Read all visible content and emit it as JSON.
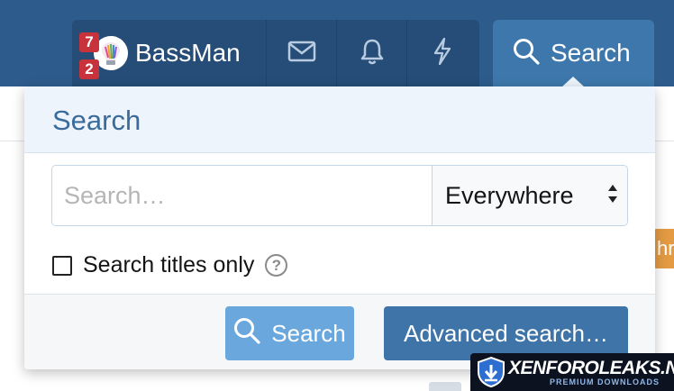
{
  "header": {
    "user": {
      "name": "BassMan",
      "badges": [
        "7",
        "2"
      ]
    },
    "nav_icons": [
      "envelope-icon",
      "bell-icon",
      "lightning-icon"
    ],
    "search_tab_label": "Search"
  },
  "search_menu": {
    "title": "Search",
    "input": {
      "placeholder": "Search…",
      "value": ""
    },
    "scope": {
      "selected": "Everywhere"
    },
    "titles_only": {
      "label": "Search titles only",
      "checked": false,
      "help_glyph": "?"
    },
    "buttons": {
      "search": "Search",
      "advanced": "Advanced search…"
    }
  },
  "background": {
    "orange_tab_text": "hre"
  },
  "watermark": {
    "title": "XENFOROLEAKS.NET",
    "subtitle": "PREMIUM DOWNLOADS"
  },
  "colors": {
    "header_bg": "#2d5b8b",
    "nav_group_bg": "#254d77",
    "active_tab_bg": "#3d77ab",
    "menu_header_bg": "#edf4fb",
    "primary_button": "#3f74a8",
    "search_button": "#6aa7dd",
    "badge_red": "#c8323a",
    "orange_accent": "#e39a42"
  }
}
